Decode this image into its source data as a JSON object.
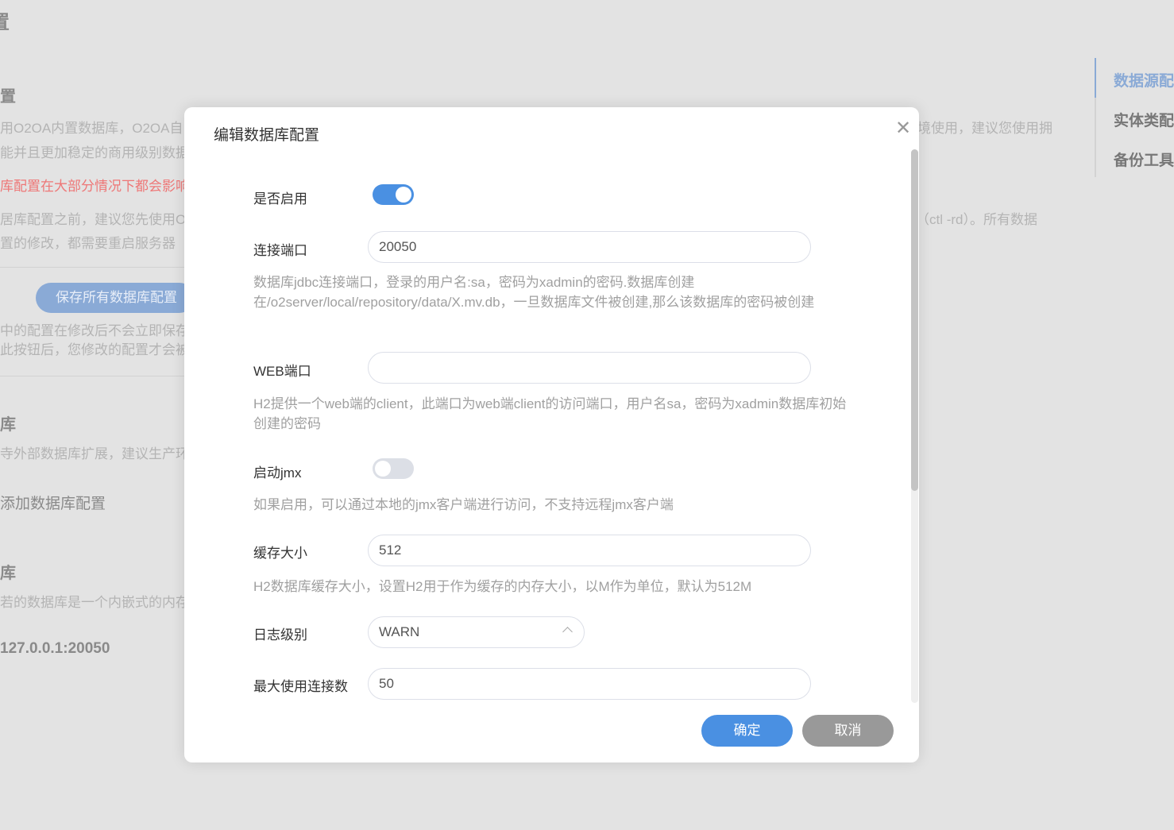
{
  "background": {
    "page_title": "置",
    "section1_title": "置",
    "line1": "用O2OA内置数据库，O2OA自",
    "line1_right": "境使用，建议您使用拥",
    "line2": "能并且更加稳定的商用级别数据",
    "warning": "库配置在大部分情况下都会影响",
    "line3": "居库配置之前，建议您先使用O",
    "line3_right": "（ctl -rd）。所有数据",
    "line4": "置的修改，都需要重启服务器",
    "save_all_button": "保存所有数据库配置",
    "save_note1": "中的配置在修改后不会立即保存",
    "save_note2": "此按钮后，您修改的配置才会被",
    "section2_title": "库",
    "section2_desc": "寺外部数据库扩展，建议生产环",
    "add_db": "添加数据库配置",
    "section3_title": "库",
    "section3_desc": "若的数据库是一个内嵌式的内存",
    "address": "127.0.0.1:20050"
  },
  "right_nav": {
    "items": [
      {
        "label": "数据源配置",
        "active": true
      },
      {
        "label": "实体类配置"
      },
      {
        "label": "备份工具"
      }
    ]
  },
  "modal": {
    "title": "编辑数据库配置",
    "close_icon": "close-icon",
    "enabled": {
      "label": "是否启用",
      "value": true
    },
    "tcp_port": {
      "label": "连接端口",
      "value": "20050",
      "desc": "数据库jdbc连接端口，登录的用户名:sa，密码为xadmin的密码.数据库创建在/o2server/local/repository/data/X.mv.db，一旦数据库文件被创建,那么该数据库的密码被创建"
    },
    "web_port": {
      "label": "WEB端口",
      "value": "",
      "desc": "H2提供一个web端的client，此端口为web端client的访问端口，用户名sa，密码为xadmin数据库初始创建的密码"
    },
    "jmx": {
      "label": "启动jmx",
      "value": false,
      "desc": "如果启用，可以通过本地的jmx客户端进行访问，不支持远程jmx客户端"
    },
    "cache_size": {
      "label": "缓存大小",
      "value": "512",
      "desc": "H2数据库缓存大小，设置H2用于作为缓存的内存大小，以M作为单位，默认为512M"
    },
    "log_level": {
      "label": "日志级别",
      "value": "WARN"
    },
    "max_conn": {
      "label": "最大使用连接数",
      "value": "50"
    },
    "confirm": "确定",
    "cancel": "取消"
  },
  "colors": {
    "primary": "#4a90e2",
    "cancel": "#999999",
    "toggle_off": "#dcdfe6"
  }
}
